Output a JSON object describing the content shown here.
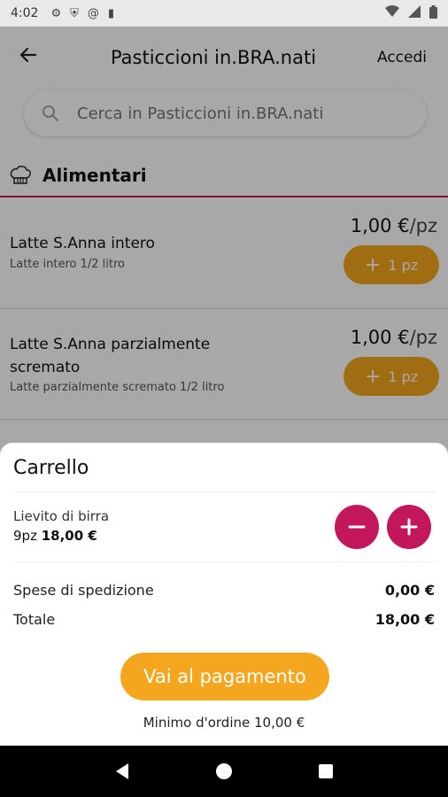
{
  "status_bar": {
    "time": "4:02",
    "icons": [
      "gear-icon",
      "shield-icon",
      "at-icon",
      "sd-card-icon"
    ],
    "right_icons": [
      "wifi-icon",
      "signal-icon",
      "battery-icon"
    ]
  },
  "header": {
    "title": "Pasticcioni in.BRA.nati",
    "login_label": "Accedi"
  },
  "search": {
    "placeholder": "Cerca in Pasticcioni in.BRA.nati"
  },
  "category": {
    "title": "Alimentari",
    "icon": "chef-hat-icon"
  },
  "products": [
    {
      "name": "Latte S.Anna intero",
      "description": "Latte intero 1/2 litro",
      "price": "1,00 €",
      "unit": "/pz",
      "add_label": "1 pz"
    },
    {
      "name_line1": "Latte S.Anna parzialmente",
      "name_line2": "scremato",
      "description": "Latte parzialmente scremato 1/2 litro",
      "price": "1,00 €",
      "unit": "/pz",
      "add_label": "1 pz"
    }
  ],
  "cart": {
    "title": "Carrello",
    "item": {
      "name": "Lievito di birra",
      "qty": "9pz",
      "price": "18,00 €"
    },
    "shipping_label": "Spese di spedizione",
    "shipping_value": "0,00 €",
    "total_label": "Totale",
    "total_value": "18,00 €",
    "pay_label": "Vai al pagamento",
    "min_order": "Minimo d'ordine 10,00 €"
  },
  "colors": {
    "accent": "#f3a61e",
    "brand": "#c2185b"
  }
}
